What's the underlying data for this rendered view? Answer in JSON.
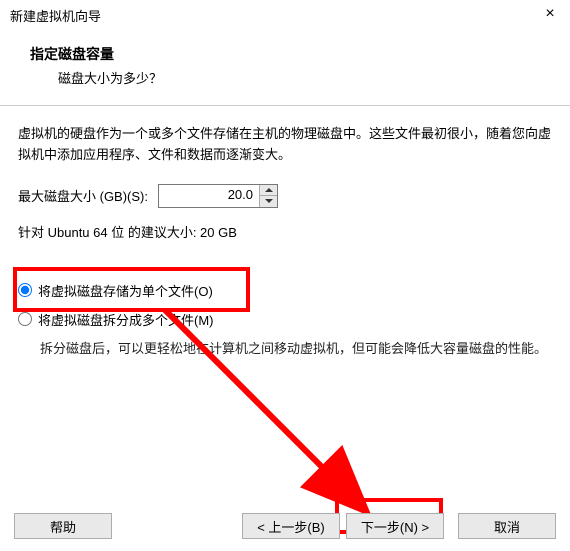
{
  "window": {
    "title": "新建虚拟机向导",
    "close": "×"
  },
  "header": {
    "title": "指定磁盘容量",
    "subtitle": "磁盘大小为多少？"
  },
  "description": "虚拟机的硬盘作为一个或多个文件存储在主机的物理磁盘中。这些文件最初很小，随着您向虚拟机中添加应用程序、文件和数据而逐渐变大。",
  "size": {
    "label": "最大磁盘大小 (GB)(S):",
    "value": "20.0",
    "recommend": "针对 Ubuntu 64 位 的建议大小: 20 GB"
  },
  "options": {
    "single": "将虚拟磁盘存储为单个文件(O)",
    "split": "将虚拟磁盘拆分成多个文件(M)",
    "split_desc": "拆分磁盘后，可以更轻松地在计算机之间移动虚拟机，但可能会降低大容量磁盘的性能。"
  },
  "buttons": {
    "help": "帮助",
    "back": "< 上一步(B)",
    "next": "下一步(N) >",
    "cancel": "取消"
  }
}
